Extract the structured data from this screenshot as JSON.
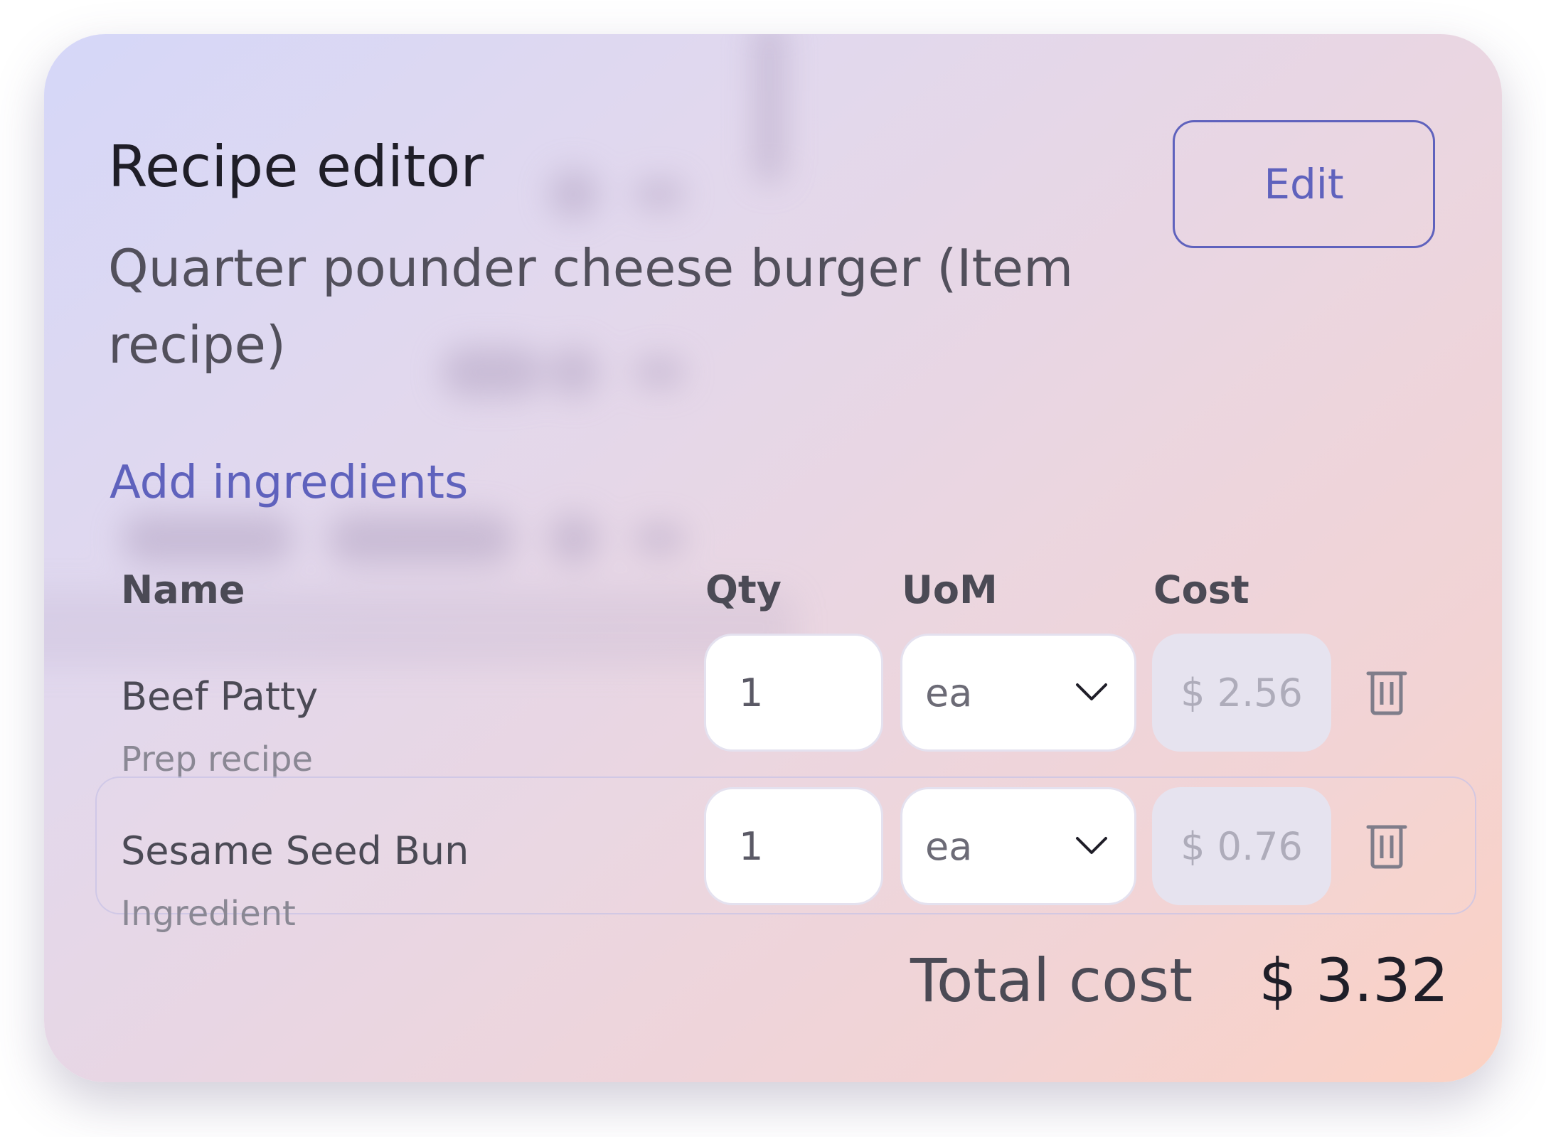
{
  "header": {
    "title": "Recipe editor",
    "subtitle": "Quarter pounder cheese burger (Item recipe)",
    "edit_label": "Edit"
  },
  "add_ingredients_label": "Add ingredients",
  "table": {
    "columns": [
      "Name",
      "Qty",
      "UoM",
      "Cost"
    ],
    "rows": [
      {
        "name": "Beef Patty",
        "type": "Prep recipe",
        "qty": "1",
        "uom": "ea",
        "cost": "$ 2.56"
      },
      {
        "name": "Sesame Seed Bun",
        "type": "Ingredient",
        "qty": "1",
        "uom": "ea",
        "cost": "$ 0.76"
      }
    ]
  },
  "footer": {
    "total_label": "Total cost",
    "total_value": "$ 3.32"
  },
  "colors": {
    "accent": "#5f62bd",
    "text_dark": "#1f1e28",
    "text_mid": "#4b4a55",
    "text_muted": "#8a8894"
  },
  "icons": {
    "dropdown": "chevron-down-icon",
    "delete": "trash-icon"
  }
}
